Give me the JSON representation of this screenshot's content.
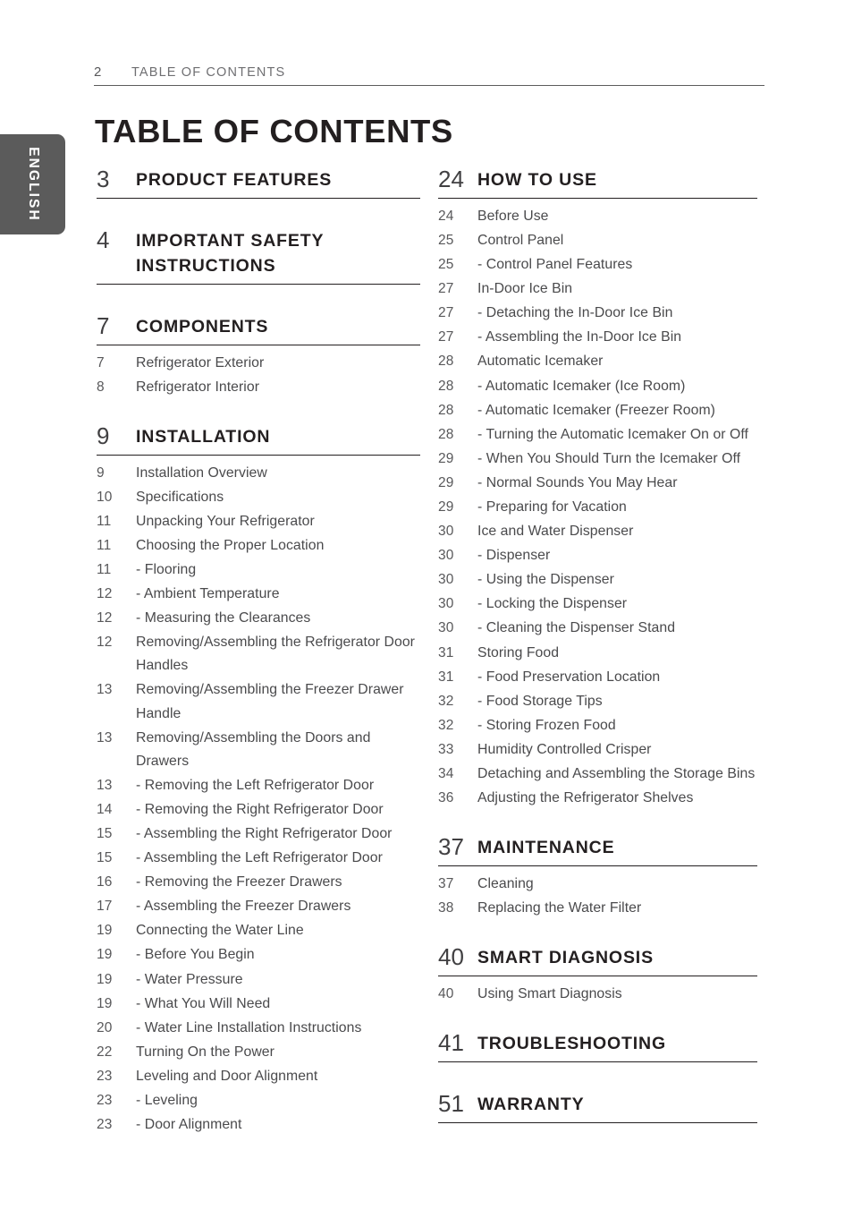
{
  "running_header": {
    "page_number": "2",
    "title": "TABLE OF CONTENTS"
  },
  "language_tab": {
    "label": "ENGLISH"
  },
  "page_title": "TABLE OF CONTENTS",
  "left_column": [
    {
      "heading": {
        "page": "3",
        "label": "PRODUCT FEATURES"
      },
      "entries": []
    },
    {
      "heading": {
        "page": "4",
        "label": "IMPORTANT SAFETY INSTRUCTIONS"
      },
      "entries": []
    },
    {
      "heading": {
        "page": "7",
        "label": "COMPONENTS"
      },
      "entries": [
        {
          "page": "7",
          "label": "Refrigerator Exterior"
        },
        {
          "page": "8",
          "label": "Refrigerator Interior"
        }
      ]
    },
    {
      "heading": {
        "page": "9",
        "label": "INSTALLATION"
      },
      "entries": [
        {
          "page": "9",
          "label": "Installation Overview"
        },
        {
          "page": "10",
          "label": "Specifications"
        },
        {
          "page": "11",
          "label": "Unpacking Your Refrigerator"
        },
        {
          "page": "11",
          "label": "Choosing the Proper Location"
        },
        {
          "page": "11",
          "label": "- Flooring"
        },
        {
          "page": "12",
          "label": "- Ambient Temperature"
        },
        {
          "page": "12",
          "label": "- Measuring the Clearances"
        },
        {
          "page": "12",
          "label": "Removing/Assembling the Refrigerator Door Handles"
        },
        {
          "page": "13",
          "label": "Removing/Assembling the Freezer Drawer Handle"
        },
        {
          "page": "13",
          "label": "Removing/Assembling the Doors and Drawers"
        },
        {
          "page": "13",
          "label": "- Removing the Left Refrigerator Door"
        },
        {
          "page": "14",
          "label": "- Removing the Right Refrigerator Door"
        },
        {
          "page": "15",
          "label": "- Assembling the Right Refrigerator Door"
        },
        {
          "page": "15",
          "label": "- Assembling the Left Refrigerator Door"
        },
        {
          "page": "16",
          "label": "- Removing the Freezer Drawers"
        },
        {
          "page": "17",
          "label": "- Assembling the Freezer Drawers"
        },
        {
          "page": "19",
          "label": "Connecting the Water Line"
        },
        {
          "page": "19",
          "label": "- Before You Begin"
        },
        {
          "page": "19",
          "label": "- Water Pressure"
        },
        {
          "page": "19",
          "label": "- What You Will Need"
        },
        {
          "page": "20",
          "label": "- Water Line Installation Instructions"
        },
        {
          "page": "22",
          "label": "Turning On the Power"
        },
        {
          "page": "23",
          "label": "Leveling and Door Alignment"
        },
        {
          "page": "23",
          "label": "- Leveling"
        },
        {
          "page": "23",
          "label": "- Door Alignment"
        }
      ]
    }
  ],
  "right_column": [
    {
      "heading": {
        "page": "24",
        "label": "HOW TO USE"
      },
      "entries": [
        {
          "page": "24",
          "label": "Before Use"
        },
        {
          "page": "25",
          "label": "Control Panel"
        },
        {
          "page": "25",
          "label": "- Control Panel Features"
        },
        {
          "page": "27",
          "label": "In-Door Ice Bin"
        },
        {
          "page": "27",
          "label": "- Detaching the In-Door Ice Bin"
        },
        {
          "page": "27",
          "label": "- Assembling the In-Door Ice Bin"
        },
        {
          "page": "28",
          "label": "Automatic Icemaker"
        },
        {
          "page": "28",
          "label": "- Automatic Icemaker (Ice Room)"
        },
        {
          "page": "28",
          "label": "- Automatic Icemaker (Freezer Room)"
        },
        {
          "page": "28",
          "label": "- Turning the Automatic Icemaker On or Off"
        },
        {
          "page": "29",
          "label": "- When You Should Turn the Icemaker Off"
        },
        {
          "page": "29",
          "label": "- Normal Sounds You May Hear"
        },
        {
          "page": "29",
          "label": "- Preparing for Vacation"
        },
        {
          "page": "30",
          "label": "Ice and Water Dispenser"
        },
        {
          "page": "30",
          "label": "- Dispenser"
        },
        {
          "page": "30",
          "label": "- Using the Dispenser"
        },
        {
          "page": "30",
          "label": "- Locking the Dispenser"
        },
        {
          "page": "30",
          "label": "- Cleaning the Dispenser Stand"
        },
        {
          "page": "31",
          "label": "Storing Food"
        },
        {
          "page": "31",
          "label": "- Food Preservation Location"
        },
        {
          "page": "32",
          "label": "- Food Storage Tips"
        },
        {
          "page": "32",
          "label": "- Storing Frozen Food"
        },
        {
          "page": "33",
          "label": "Humidity Controlled Crisper"
        },
        {
          "page": "34",
          "label": "Detaching and Assembling the Storage Bins"
        },
        {
          "page": "36",
          "label": "Adjusting the Refrigerator Shelves"
        }
      ]
    },
    {
      "heading": {
        "page": "37",
        "label": "MAINTENANCE"
      },
      "entries": [
        {
          "page": "37",
          "label": "Cleaning"
        },
        {
          "page": "38",
          "label": "Replacing the Water Filter"
        }
      ]
    },
    {
      "heading": {
        "page": "40",
        "label": "SMART DIAGNOSIS"
      },
      "entries": [
        {
          "page": "40",
          "label": "Using Smart Diagnosis"
        }
      ]
    },
    {
      "heading": {
        "page": "41",
        "label": "TROUBLESHOOTING"
      },
      "entries": []
    },
    {
      "heading": {
        "page": "51",
        "label": "WARRANTY"
      },
      "entries": []
    }
  ],
  "colors": {
    "tab_background": "#5b5b5b",
    "rule": "#231f20",
    "body_text": "#4a4a4c"
  }
}
